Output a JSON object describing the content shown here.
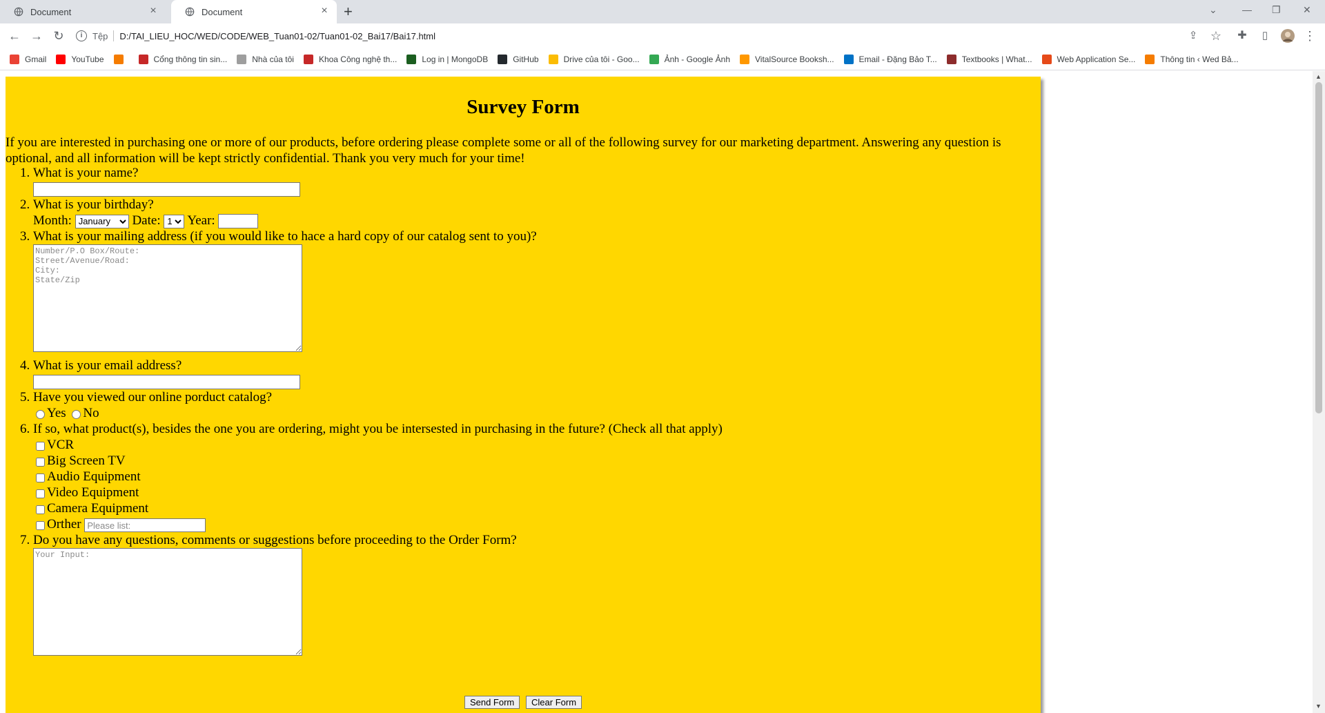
{
  "browser": {
    "tabs": [
      {
        "label": "Document"
      },
      {
        "label": "Document"
      }
    ],
    "address": {
      "scheme": "Tệp",
      "url": "D:/TAI_LIEU_HOC/WED/CODE/WEB_Tuan01-02/Tuan01-02_Bai17/Bai17.html"
    },
    "bookmarks": [
      {
        "label": "Gmail",
        "color": "#ea4335"
      },
      {
        "label": "YouTube",
        "color": "#ff0000"
      },
      {
        "label": "",
        "color": "#f57c00"
      },
      {
        "label": "Cổng thông tin sin...",
        "color": "#c62828"
      },
      {
        "label": "Nhà của tôi",
        "color": "#9e9e9e"
      },
      {
        "label": "Khoa Công nghệ th...",
        "color": "#c62828"
      },
      {
        "label": "Log in | MongoDB",
        "color": "#1b5e20"
      },
      {
        "label": "GitHub",
        "color": "#24292e"
      },
      {
        "label": "Drive của tôi - Goo...",
        "color": "#fbbc04"
      },
      {
        "label": "Ảnh - Google Ảnh",
        "color": "#34a853"
      },
      {
        "label": "VitalSource Booksh...",
        "color": "#ff9800"
      },
      {
        "label": "Email - Đặng Bảo T...",
        "color": "#0072c6"
      },
      {
        "label": "Textbooks | What...",
        "color": "#8d2c2c"
      },
      {
        "label": "Web Application Se...",
        "color": "#e64a19"
      },
      {
        "label": "Thông tin ‹ Wed Bả...",
        "color": "#f57c00"
      }
    ]
  },
  "survey": {
    "title": "Survey Form",
    "intro": "If you are interested in purchasing one or more of our products, before ordering please complete some or all of the following survey for our marketing department. Answering any question is optional, and all information will be kept strictly confidential. Thank you very much for your time!",
    "q1": "What is your name?",
    "q2": "What is your birthday?",
    "month_label": "Month:",
    "month_value": "January",
    "date_label": "Date:",
    "date_value": "1",
    "year_label": "Year:",
    "q3": "What is your mailing address (if you would like to hace a hard copy of our catalog sent to you)?",
    "address_placeholder": "Number/P.O Box/Route:\nStreet/Avenue/Road:\nCity:\nState/Zip",
    "q4": "What is your email address?",
    "q5": "Have you viewed our online porduct catalog?",
    "yes": "Yes",
    "no": "No",
    "q6": "If so, what product(s), besides the one you are ordering, might you be intersested in purchasing in the future? (Check all that apply)",
    "products": [
      "VCR",
      "Big Screen TV",
      "Audio Equipment",
      "Video Equipment",
      "Camera Equipment",
      "Orther"
    ],
    "other_placeholder": "Please list:",
    "q7": "Do you have any questions, comments or suggestions before proceeding to the Order Form?",
    "comments_placeholder": "Your Input:",
    "send_button": "Send Form",
    "clear_button": "Clear Form"
  }
}
